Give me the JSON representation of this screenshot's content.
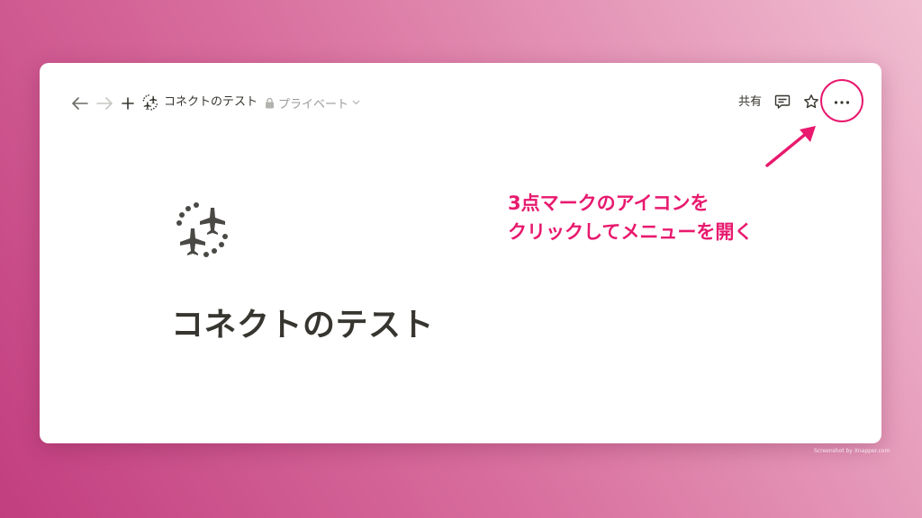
{
  "topbar": {
    "back_icon": "arrow-left-icon",
    "forward_icon": "arrow-right-icon",
    "new_icon": "plus-icon",
    "page_icon": "airplanes-icon",
    "page_title": "コネクトのテスト",
    "privacy_label": "プライベート",
    "lock_icon": "lock-icon",
    "privacy_caret_icon": "chevron-down-icon",
    "share_label": "共有",
    "comment_icon": "comment-icon",
    "favorite_icon": "star-icon",
    "more_icon": "more-horizontal-icon"
  },
  "page": {
    "icon": "airplanes-icon",
    "title": "コネクトのテスト"
  },
  "annotation": {
    "line1": "3点マークのアイコンを",
    "line2": "クリックしてメニューを開く",
    "color": "#e8196e"
  },
  "credit": "Screenshot by Xnapper.com",
  "colors": {
    "text": "#37352f",
    "muted": "#9b9a97",
    "accent": "#e8196e"
  }
}
